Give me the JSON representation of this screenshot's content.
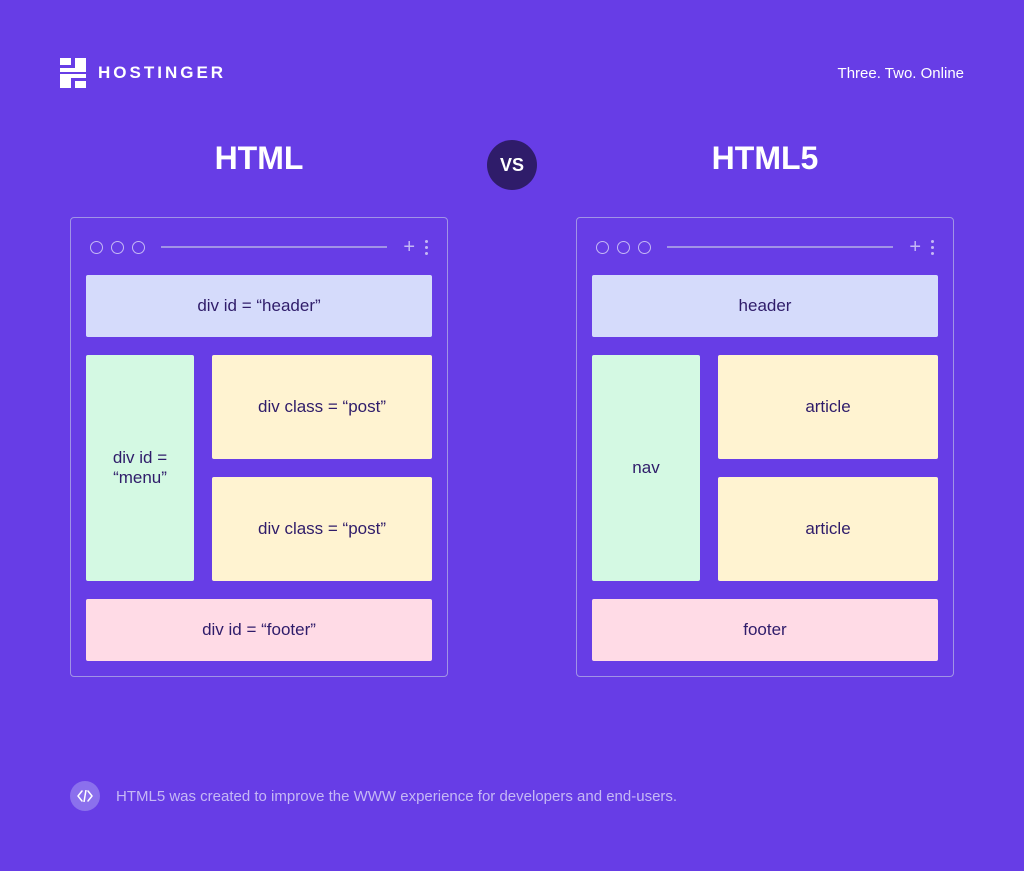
{
  "brand": {
    "name": "HOSTINGER",
    "tagline": "Three. Two. Online"
  },
  "comparison": {
    "vs_label": "VS",
    "left": {
      "title": "HTML",
      "blocks": {
        "header": "div id = “header”",
        "nav": "div id = “menu”",
        "article1": "div class = “post”",
        "article2": "div class = “post”",
        "footer": "div id = “footer”"
      }
    },
    "right": {
      "title": "HTML5",
      "blocks": {
        "header": "header",
        "nav": "nav",
        "article1": "article",
        "article2": "article",
        "footer": "footer"
      }
    }
  },
  "caption": "HTML5 was created to improve the WWW experience for developers and end-users."
}
